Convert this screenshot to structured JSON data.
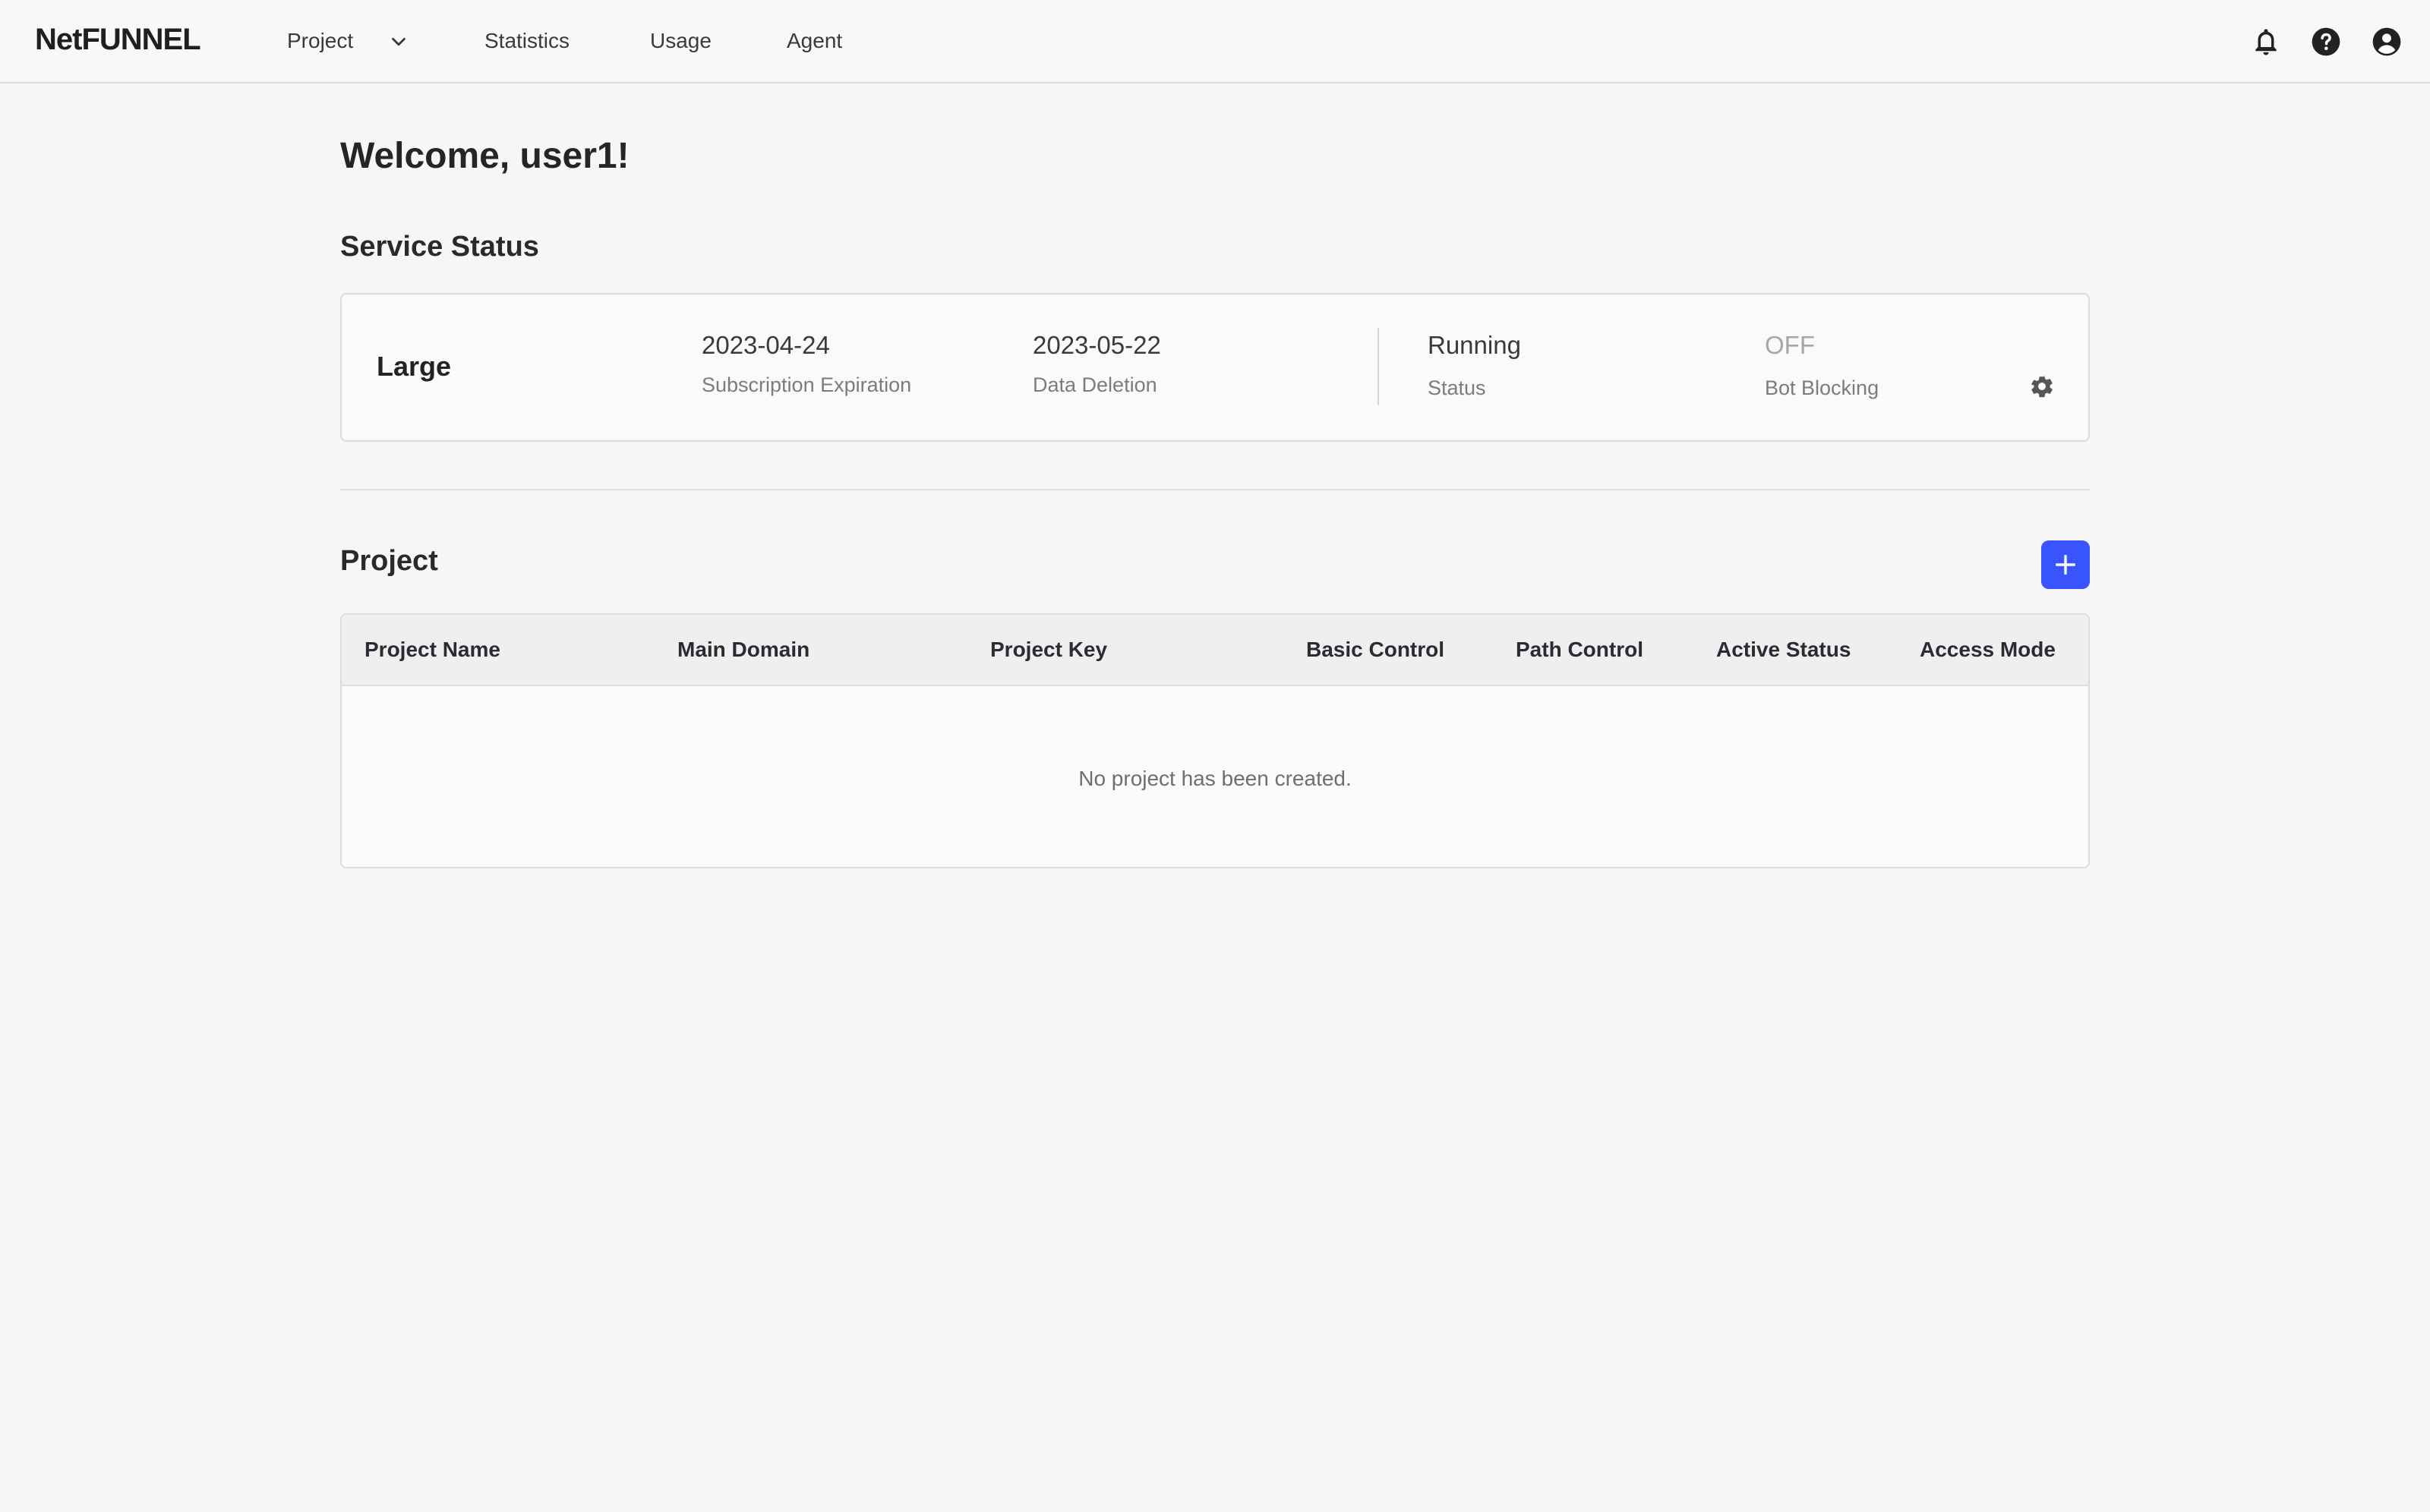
{
  "nav": {
    "logo": "NetFUNNEL",
    "items": [
      "Project",
      "Statistics",
      "Usage",
      "Agent"
    ],
    "icons": [
      "bell-icon",
      "help-icon",
      "account-icon"
    ]
  },
  "welcome": "Welcome, user1!",
  "service_status": {
    "title": "Service Status",
    "plan": "Large",
    "subscription_expiration": {
      "value": "2023-04-24",
      "label": "Subscription Expiration"
    },
    "data_deletion": {
      "value": "2023-05-22",
      "label": "Data Deletion"
    },
    "status": {
      "value": "Running",
      "label": "Status"
    },
    "bot_blocking": {
      "value": "OFF",
      "label": "Bot Blocking"
    }
  },
  "project": {
    "title": "Project",
    "columns": [
      "Project Name",
      "Main Domain",
      "Project Key",
      "Basic Control",
      "Path Control",
      "Active Status",
      "Access Mode"
    ],
    "empty_message": "No project has been created."
  },
  "colors": {
    "accent": "#3754ff",
    "background": "#f6f6f8"
  }
}
